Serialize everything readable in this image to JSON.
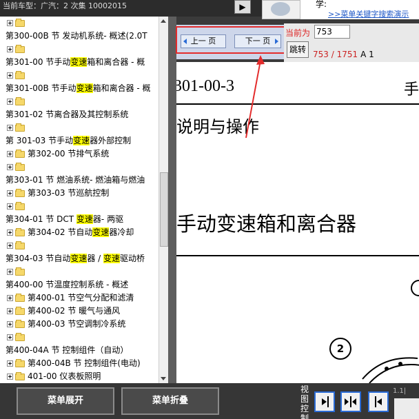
{
  "window": {
    "title": "当前车型：广汽：2 次集 10002015",
    "mascot_icon": "mascot-icon",
    "ad_question": "学:",
    "ad_link": ">>菜单关键字搜索演示"
  },
  "tree": {
    "items": [
      {
        "expand": true,
        "folder": true,
        "text": "",
        "hl": ""
      },
      {
        "expand": false,
        "folder": false,
        "text": "第300-00B 节 发动机系统- 概述(2.0T",
        "hl": ""
      },
      {
        "expand": true,
        "folder": true,
        "text": "",
        "hl": ""
      },
      {
        "expand": false,
        "folder": false,
        "text_pre": "第301-00 节手动",
        "text_hl": "变速",
        "text_post": "箱和离合器 - 概",
        "hl": "yes"
      },
      {
        "expand": true,
        "folder": true,
        "text": "",
        "hl": ""
      },
      {
        "expand": false,
        "folder": false,
        "text_pre": "第301-00B 节手动",
        "text_hl": "变速",
        "text_post": "箱和离合器 - 概",
        "hl": "yes"
      },
      {
        "expand": true,
        "folder": true,
        "text": "",
        "hl": ""
      },
      {
        "expand": false,
        "folder": false,
        "text": "第301-02 节离合器及其控制系统",
        "hl": ""
      },
      {
        "expand": true,
        "folder": true,
        "text": "",
        "hl": ""
      },
      {
        "expand": false,
        "folder": false,
        "text_pre": "第 301-03 节手动",
        "text_hl": "变速",
        "text_post": "器外部控制",
        "hl": "yes"
      },
      {
        "expand": true,
        "folder": true,
        "text": "第302-00 节排气系统",
        "hl": ""
      },
      {
        "expand": true,
        "folder": true,
        "text": "",
        "hl": ""
      },
      {
        "expand": false,
        "folder": false,
        "text": "第303-01 节 燃油系统- 燃油箱与燃油",
        "hl": ""
      },
      {
        "expand": true,
        "folder": true,
        "text": "第303-03 节巡航控制",
        "hl": ""
      },
      {
        "expand": true,
        "folder": true,
        "text": "",
        "hl": ""
      },
      {
        "expand": false,
        "folder": false,
        "text_pre": "第304-01 节 DCT ",
        "text_hl": "变速",
        "text_post": "器- 两驱",
        "hl": "yes"
      },
      {
        "expand": true,
        "folder": true,
        "text_pre": "第304-02 节自动",
        "text_hl": "变速",
        "text_post": "器冷却",
        "hl": "yes"
      },
      {
        "expand": true,
        "folder": true,
        "text": "",
        "hl": ""
      },
      {
        "expand": false,
        "folder": false,
        "text_pre": "第304-03 节自动",
        "text_hl": "变速",
        "text_post": "器 / ",
        "text_hl2": "变速",
        "text_post2": "驱动桥",
        "hl": "yes2"
      },
      {
        "expand": true,
        "folder": true,
        "text": "",
        "hl": ""
      },
      {
        "expand": false,
        "folder": false,
        "text": "第400-00 节温度控制系统 - 概述",
        "hl": ""
      },
      {
        "expand": true,
        "folder": true,
        "text": "第400-01 节空气分配和滤清",
        "hl": ""
      },
      {
        "expand": true,
        "folder": true,
        "text": "第400-02 节 暖气与通风",
        "hl": ""
      },
      {
        "expand": true,
        "folder": true,
        "text": "第400-03 节空调制冷系统",
        "hl": ""
      },
      {
        "expand": true,
        "folder": true,
        "text": "",
        "hl": ""
      },
      {
        "expand": false,
        "folder": false,
        "text": "第400-04A 节 控制组件（自动）",
        "hl": ""
      },
      {
        "expand": true,
        "folder": true,
        "text": "第400-04B 节 控制组件(电动)",
        "hl": ""
      },
      {
        "expand": true,
        "folder": true,
        "text": "401-00 仪表板照明",
        "hl": ""
      }
    ]
  },
  "nav": {
    "prev_label": "上一 页",
    "next_label": "下一 页",
    "page_label": "当前为",
    "page_value": "753",
    "jump_label": "跳转",
    "page_count": "753 / 1751",
    "sheet_label": "A 1"
  },
  "document": {
    "code": "301-00-3",
    "header_right": "手",
    "section": "说明与操作",
    "title": "手动变速箱和离合器",
    "callout": "2"
  },
  "bottom": {
    "expand_label": "菜单展开",
    "collapse_label": "菜单折叠",
    "view_label": "视 图 控 制",
    "corner_text": "1.1|",
    "icons": [
      "show-right-icon",
      "split-view-icon",
      "show-left-icon"
    ]
  },
  "colors": {
    "highlight": "#ffff00",
    "annotation_red": "#e32b2b",
    "nav_blue": "#2a6bd6"
  }
}
